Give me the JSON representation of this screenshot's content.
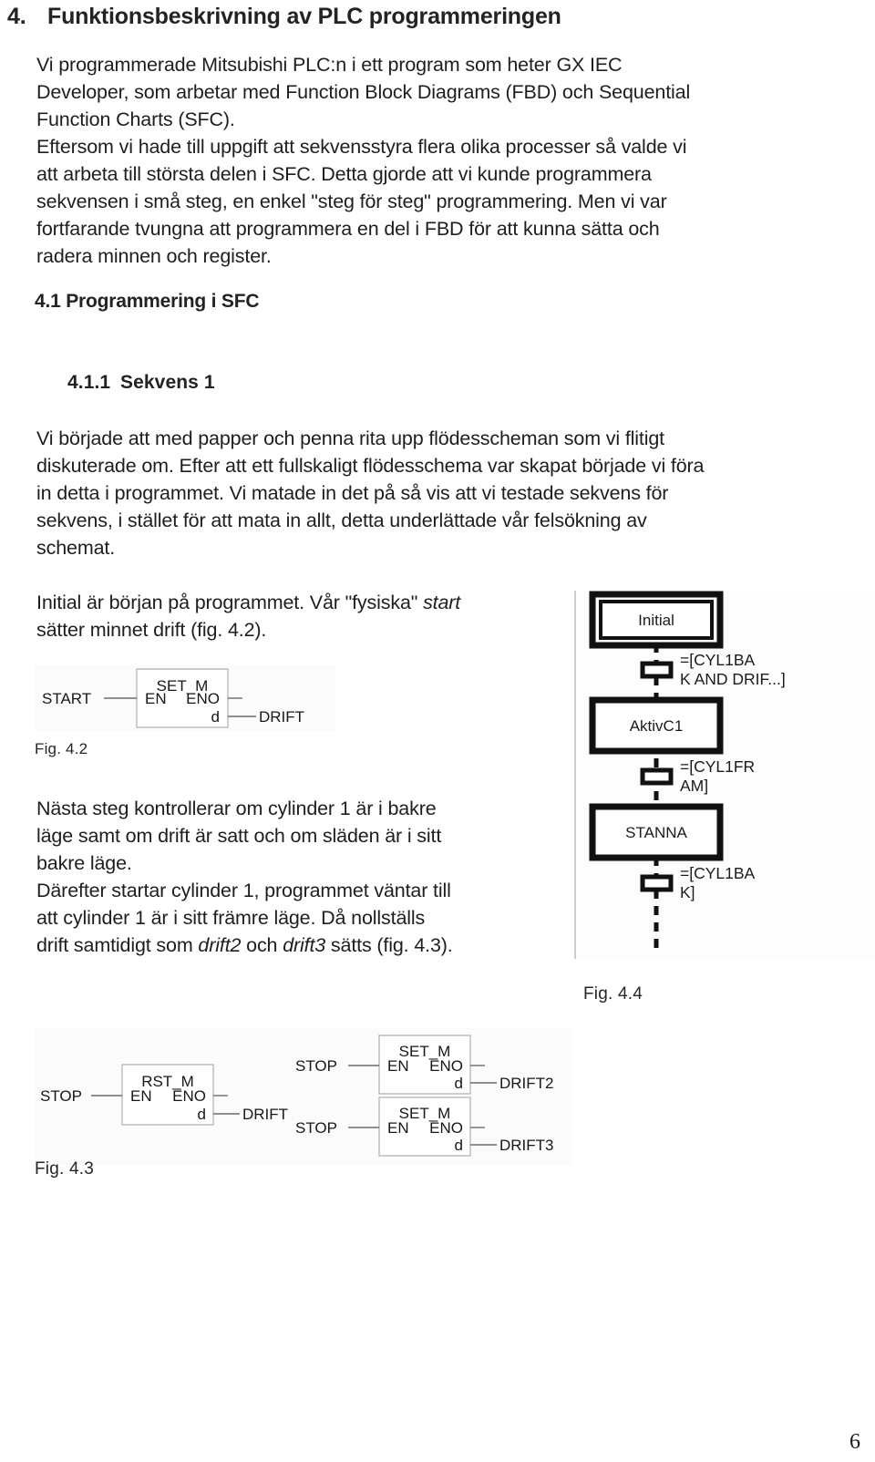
{
  "document": {
    "page_number": "6",
    "heading1": {
      "number": "4.",
      "text": "Funktionsbeskrivning av PLC programmeringen"
    },
    "heading2": {
      "text": "4.1 Programmering i SFC"
    },
    "heading3": {
      "number": "4.1.1",
      "text": "Sekvens 1"
    },
    "paragraphs": {
      "intro_line1": "Vi programmerade Mitsubishi PLC:n i ett program som heter GX IEC",
      "intro_line2": "Developer, som arbetar med Function Block Diagrams (FBD) och Sequential",
      "intro_line3": "Function Charts (SFC).",
      "intro_line4": "Eftersom vi hade till uppgift att sekvensstyra flera olika processer så valde vi",
      "intro_line5": "att arbeta till största delen i SFC. Detta gjorde att vi kunde programmera",
      "intro_line6": "sekvensen i små steg, en enkel \"steg för steg\" programmering. Men vi var",
      "intro_line7": "fortfarande tvungna att programmera en del i FBD för att kunna sätta och",
      "intro_line8": "radera minnen och register.",
      "sek1_line1": "Vi började att med papper och penna rita upp flödesscheman som vi flitigt",
      "sek1_line2": "diskuterade om. Efter att ett fullskaligt flödesschema var skapat började vi föra",
      "sek1_line3": "in detta i programmet. Vi matade in det på så vis att vi testade sekvens för",
      "sek1_line4": "sekvens, i stället för att mata in allt, detta underlättade vår felsökning av",
      "sek1_line5": "schemat.",
      "initial_line1_a": "Initial är början på programmet. Vår \"fysiska\" ",
      "initial_line1_em": "start",
      "initial_line2": "sätter minnet drift (fig. 4.2).",
      "nasta_line1": "Nästa steg kontrollerar om cylinder 1 är i bakre",
      "nasta_line2": "läge samt om drift är satt och om släden är i sitt",
      "nasta_line3": "bakre läge.",
      "nasta_line4": "Därefter startar cylinder 1, programmet väntar till",
      "nasta_line5": "att cylinder 1 är i sitt främre läge. Då nollställs",
      "nasta_line6_a": "drift samtidigt som ",
      "nasta_line6_em1": "drift2",
      "nasta_line6_b": " och ",
      "nasta_line6_em2": "drift3",
      "nasta_line6_c": " sätts (fig. 4.3)."
    },
    "captions": {
      "fig42": "Fig. 4.2",
      "fig43": "Fig. 4.3",
      "fig44": "Fig. 4.4"
    }
  },
  "fig42": {
    "block": {
      "title": "SET_M",
      "en": "EN",
      "eno": "ENO",
      "d": "d"
    },
    "input_label": "START",
    "output_label": "DRIFT"
  },
  "fig43": {
    "left_block": {
      "title": "RST_M",
      "en": "EN",
      "eno": "ENO",
      "d": "d",
      "input_label": "STOP",
      "output_label": "DRIFT"
    },
    "right_block_top": {
      "title": "SET_M",
      "en": "EN",
      "eno": "ENO",
      "d": "d",
      "input_label": "STOP",
      "output_label": "DRIFT2"
    },
    "right_block_bottom": {
      "title": "SET_M",
      "en": "EN",
      "eno": "ENO",
      "d": "d",
      "input_label": "STOP",
      "output_label": "DRIFT3"
    }
  },
  "fig44": {
    "steps": [
      {
        "name": "Initial",
        "initial": true
      },
      {
        "name": "AktivC1",
        "initial": false
      },
      {
        "name": "STANNA",
        "initial": false
      }
    ],
    "transitions": [
      {
        "line1": "=[CYL1BA",
        "line2": "K AND DRIF...]"
      },
      {
        "line1": "=[CYL1FR",
        "line2": "AM]"
      },
      {
        "line1": "=[CYL1BA",
        "line2": "K]"
      }
    ]
  }
}
